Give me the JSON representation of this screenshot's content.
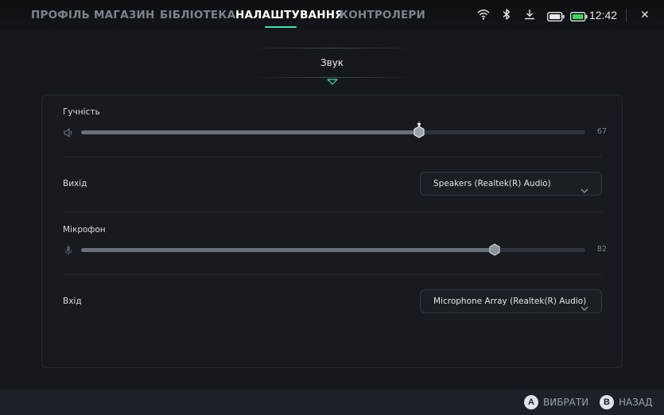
{
  "nav": {
    "tabs": [
      {
        "label": "ПРОФІЛЬ",
        "active": false
      },
      {
        "label": "МАГАЗИН",
        "active": false
      },
      {
        "label": "БІБЛІОТЕКА",
        "active": false
      },
      {
        "label": "НАЛАШТУВАННЯ",
        "active": true
      },
      {
        "label": "КОНТРОЛЕРИ",
        "active": false
      }
    ],
    "accent_color": "#3fe0b0"
  },
  "status": {
    "icons": [
      "wifi-icon",
      "bluetooth-icon",
      "download-icon",
      "battery-icon",
      "battery-charging-icon"
    ],
    "time": "12:42"
  },
  "subtab": {
    "label": "Звук"
  },
  "settings": {
    "volume": {
      "label": "Гучність",
      "value": "67",
      "level": 0.67,
      "icon": "speaker-icon"
    },
    "output": {
      "label": "Вихід",
      "selected": "Speakers (Realtek(R) Audio)"
    },
    "microphone": {
      "label": "Мікрофон",
      "value": "82",
      "level": 0.82,
      "icon": "microphone-icon"
    },
    "input": {
      "label": "Вхід",
      "selected": "Microphone Array (Realtek(R) Audio)"
    }
  },
  "footer": {
    "select": {
      "button": "A",
      "label": "ВИБРАТИ"
    },
    "back": {
      "button": "B",
      "label": "НАЗАД"
    }
  }
}
